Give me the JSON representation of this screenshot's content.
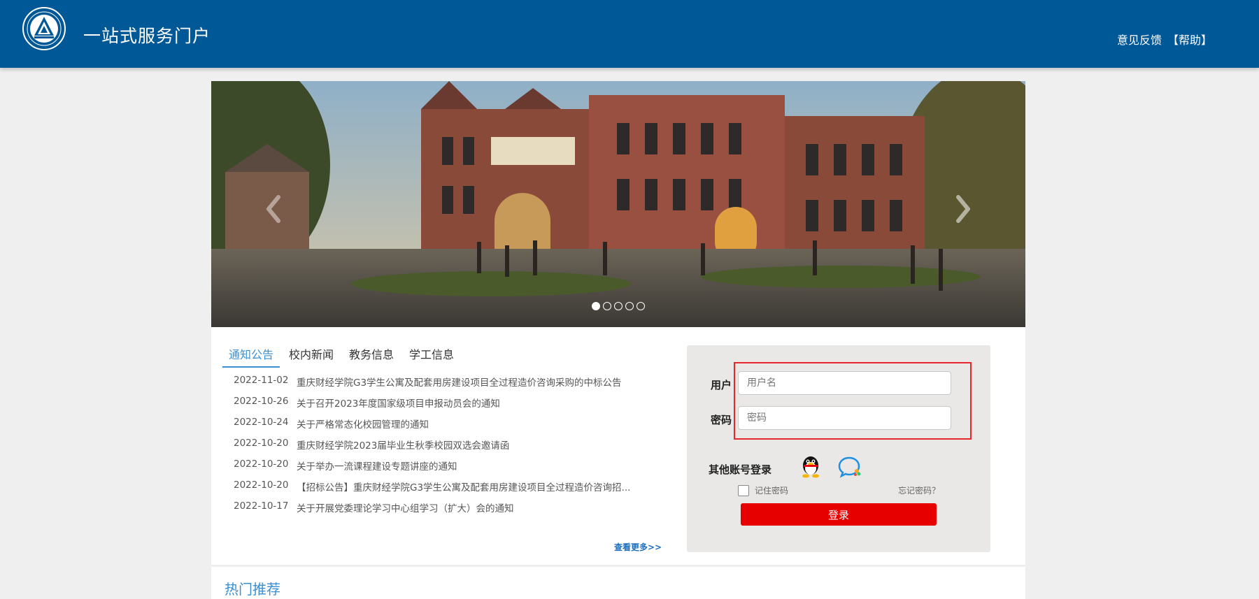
{
  "header": {
    "title": "一站式服务门户",
    "feedback": "意见反馈",
    "help": "【帮助】"
  },
  "carousel": {
    "slide_count": 5,
    "active_index": 0
  },
  "news": {
    "tabs": [
      "通知公告",
      "校内新闻",
      "教务信息",
      "学工信息"
    ],
    "active_tab": 0,
    "items": [
      {
        "date": "2022-11-02",
        "title": "重庆财经学院G3学生公寓及配套用房建设项目全过程造价咨询采购的中标公告"
      },
      {
        "date": "2022-10-26",
        "title": "关于召开2023年度国家级项目申报动员会的通知"
      },
      {
        "date": "2022-10-24",
        "title": "关于严格常态化校园管理的通知"
      },
      {
        "date": "2022-10-20",
        "title": "重庆财经学院2023届毕业生秋季校园双选会邀请函"
      },
      {
        "date": "2022-10-20",
        "title": "关于举办一流课程建设专题讲座的通知"
      },
      {
        "date": "2022-10-20",
        "title": "【招标公告】重庆财经学院G3学生公寓及配套用房建设项目全过程造价咨询招..."
      },
      {
        "date": "2022-10-17",
        "title": "关于开展党委理论学习中心组学习（扩大）会的通知"
      }
    ],
    "more": "查看更多>>"
  },
  "login": {
    "user_label": "用户",
    "user_placeholder": "用户名",
    "pass_label": "密码",
    "pass_placeholder": "密码",
    "other_login": "其他账号登录",
    "remember": "记住密码",
    "forgot": "忘记密码？",
    "submit": "登录",
    "accent_color": "#e60000"
  },
  "hot": {
    "title": "热门推荐"
  },
  "colors": {
    "header_bg": "#005897",
    "link_blue": "#3a8fd3"
  }
}
